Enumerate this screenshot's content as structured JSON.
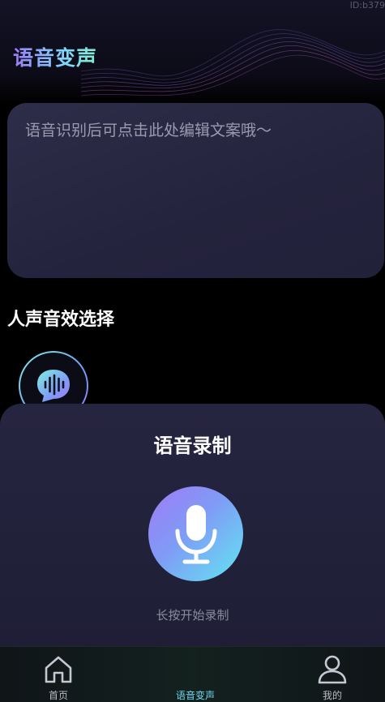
{
  "watermark": {
    "id_text": "ID:b379"
  },
  "header": {
    "title": "语音变声"
  },
  "text_card": {
    "placeholder": "语音识别后可点击此处编辑文案哦～"
  },
  "voice_effects": {
    "section_title": "人声音效选择",
    "items": [
      {
        "icon": "sound-wave-chat-icon"
      }
    ]
  },
  "recording_sheet": {
    "title": "语音录制",
    "mic_icon": "microphone-icon",
    "hint": "长按开始录制"
  },
  "tabbar": {
    "tabs": [
      {
        "label": "首页",
        "icon": "home-icon",
        "active": false
      },
      {
        "label": "语音变声",
        "icon": "voice-change-icon",
        "active": true
      },
      {
        "label": "我的",
        "icon": "user-icon",
        "active": false
      }
    ]
  },
  "colors": {
    "accent_purple": "#9b7bf5",
    "accent_cyan": "#62e6f0",
    "card_bg": "#2a2944",
    "sheet_bg": "#23223b",
    "active_tab": "#6fd8f0"
  }
}
